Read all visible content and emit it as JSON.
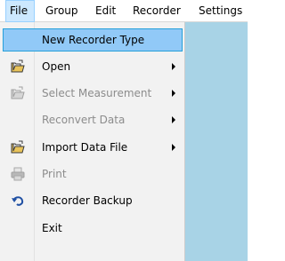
{
  "menubar": {
    "items": [
      {
        "label": "File"
      },
      {
        "label": "Group"
      },
      {
        "label": "Edit"
      },
      {
        "label": "Recorder"
      },
      {
        "label": "Settings"
      }
    ]
  },
  "file_menu": {
    "items": [
      {
        "label": "New Recorder Type",
        "highlighted": true
      },
      {
        "label": "Open",
        "icon": "open-folder-icon",
        "submenu": true
      },
      {
        "label": "Select Measurement",
        "icon": "open-folder-icon",
        "submenu": true,
        "disabled": true
      },
      {
        "label": "Reconvert Data",
        "submenu": true,
        "disabled": true
      },
      {
        "label": "Import Data File",
        "icon": "open-folder-icon",
        "submenu": true
      },
      {
        "label": "Print",
        "icon": "printer-icon",
        "disabled": true
      },
      {
        "label": "Recorder Backup",
        "icon": "undo-arrow-icon"
      },
      {
        "label": "Exit"
      }
    ]
  },
  "colors": {
    "app_background": "#a8d3e6",
    "menu_background": "#f2f2f2",
    "highlight_background": "#91c9f7",
    "highlight_border": "#26a0da",
    "disabled_text": "#8c8c8c"
  }
}
